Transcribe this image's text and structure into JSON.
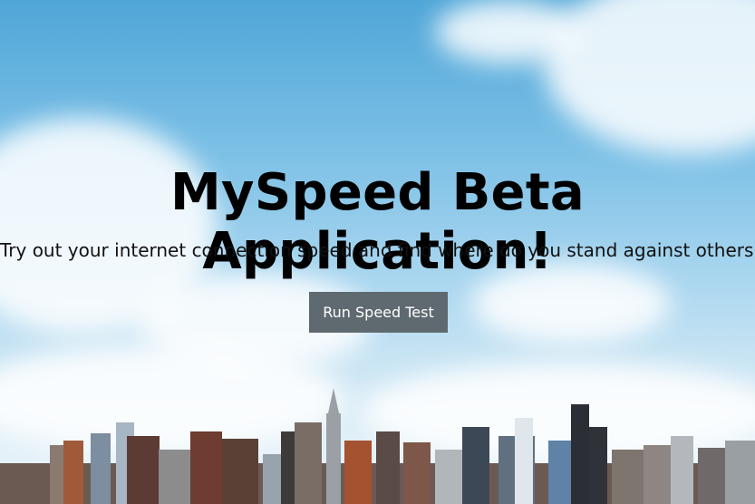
{
  "hero": {
    "title": "MySpeed Beta Application!",
    "subtitle": "Try out your internet connection speed and find where do you stand against others!",
    "button_label": "Run Speed Test"
  },
  "colors": {
    "sky_top": "#4fa6d8",
    "sky_bottom": "#eef6fb",
    "button_bg": "#5f6a70",
    "button_text": "#ffffff",
    "title_text": "#000000"
  }
}
